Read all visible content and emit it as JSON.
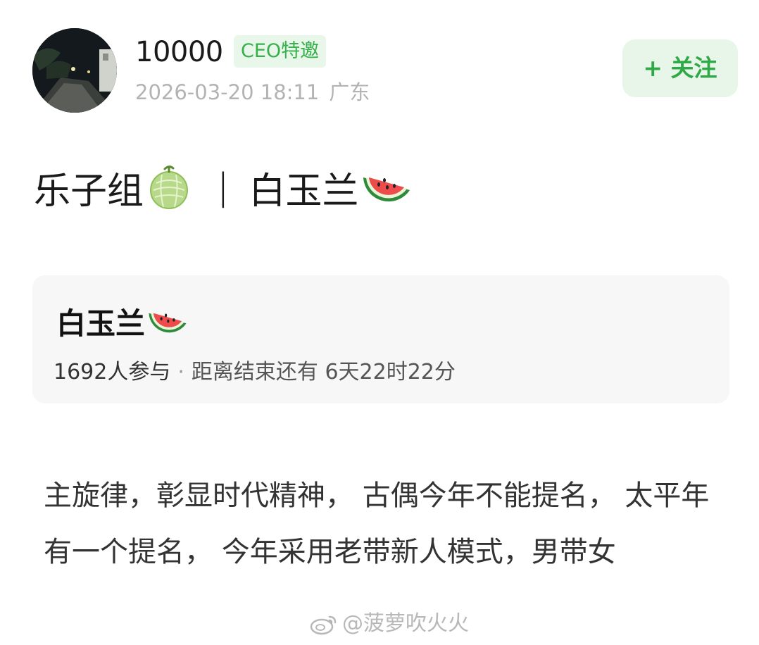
{
  "post": {
    "author": {
      "avatar_icon": "night-street-photo",
      "username": "10000",
      "badge": "CEO特邀"
    },
    "timestamp": "2026-03-20 18:11",
    "location": "广东",
    "follow_label": "+ 关注",
    "title_left": "乐子组",
    "title_left_icon": "melon-icon",
    "title_separator": "|",
    "title_right": "白玉兰",
    "title_right_icon": "watermelon-icon"
  },
  "poll": {
    "title": "白玉兰",
    "title_icon": "watermelon-icon",
    "participants": "1692人参与",
    "separator": "·",
    "countdown": "距离结束还有 6天22时22分"
  },
  "body_text": "主旋律，彰显时代精神， 古偶今年不能提名， 太平年有一个提名， 今年采用老带新人模式，男带女",
  "watermark": "@菠萝吹火火",
  "colors": {
    "accent_green": "#35b04a",
    "follow_bg": "#e8f6ea",
    "badge_bg": "#e9f7ea",
    "meta_gray": "#b3b3b3",
    "card_bg": "#f7f7f7"
  }
}
